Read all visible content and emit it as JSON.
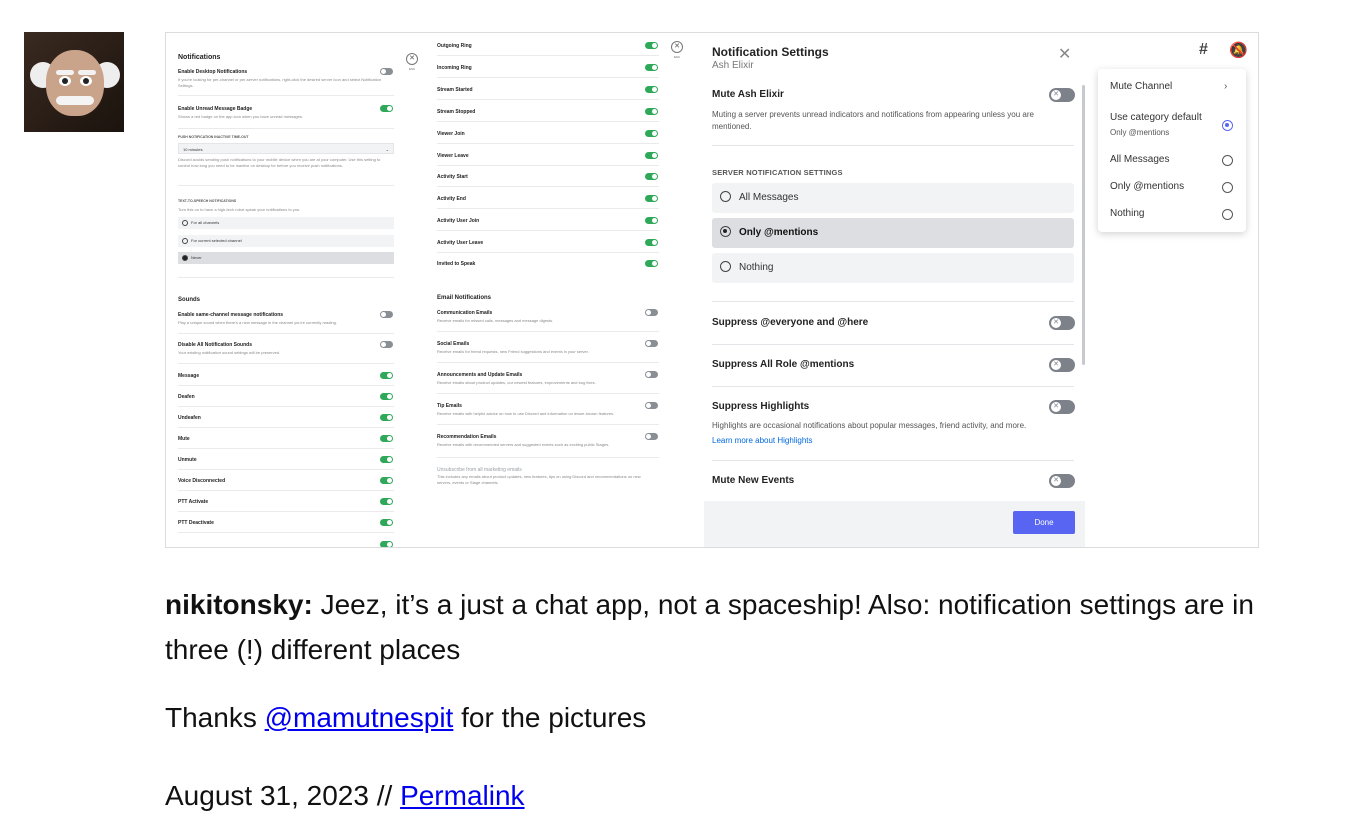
{
  "screenshot": {
    "panel1": {
      "heading": "Notifications",
      "rows": [
        {
          "label": "Enable Desktop Notifications",
          "desc": "If you're looking for per-channel or per-server notifications, right-click the desired server icon and select Notification Settings.",
          "on": false
        },
        {
          "label": "Enable Unread Message Badge",
          "desc": "Shows a red badge on the app icon when you have unread messages.",
          "on": true
        }
      ],
      "push_caption": "PUSH NOTIFICATION INACTIVE TIME-OUT",
      "push_select": "10 minutes",
      "push_desc": "Discord avoids sending push notifications to your mobile device when you are at your computer. Use this setting to control how long you need to be inactive on desktop for before you receive push notifications.",
      "tts_caption": "TEXT-TO-SPEECH NOTIFICATIONS",
      "tts_desc": "Turn this on to have a high-tech robot speak your notifications to you.",
      "tts_options": [
        "For all channels",
        "For current selected channel",
        "Never"
      ],
      "sounds_heading": "Sounds",
      "sound_rows": [
        {
          "label": "Enable same-channel message notifications",
          "desc": "Play a unique sound when there's a new message in the channel you're currently reading.",
          "on": false
        },
        {
          "label": "Disable All Notification Sounds",
          "desc": "Your existing notification sound settings will be preserved.",
          "on": false
        },
        {
          "label": "Message",
          "on": true
        },
        {
          "label": "Deafen",
          "on": true
        },
        {
          "label": "Undeafen",
          "on": true
        },
        {
          "label": "Mute",
          "on": true
        },
        {
          "label": "Unmute",
          "on": true
        },
        {
          "label": "Voice Disconnected",
          "on": true
        },
        {
          "label": "PTT Activate",
          "on": true
        },
        {
          "label": "PTT Deactivate",
          "on": true
        }
      ]
    },
    "panel2": {
      "esc_label": "ESC",
      "rows": [
        {
          "label": "Outgoing Ring",
          "on": true
        },
        {
          "label": "Incoming Ring",
          "on": true
        },
        {
          "label": "Stream Started",
          "on": true
        },
        {
          "label": "Stream Stopped",
          "on": true
        },
        {
          "label": "Viewer Join",
          "on": true
        },
        {
          "label": "Viewer Leave",
          "on": true
        },
        {
          "label": "Activity Start",
          "on": true
        },
        {
          "label": "Activity End",
          "on": true
        },
        {
          "label": "Activity User Join",
          "on": true
        },
        {
          "label": "Activity User Leave",
          "on": true
        },
        {
          "label": "Invited to Speak",
          "on": true
        }
      ],
      "email_heading": "Email Notifications",
      "email_rows": [
        {
          "label": "Communication Emails",
          "desc": "Receive emails for missed calls, messages and message digests.",
          "on": false
        },
        {
          "label": "Social Emails",
          "desc": "Receive emails for friend requests, new Friend suggestions and events in your server.",
          "on": false
        },
        {
          "label": "Announcements and Update Emails",
          "desc": "Receive emails about product updates, our newest features, improvements and bug fixes.",
          "on": false
        },
        {
          "label": "Tip Emails",
          "desc": "Receive emails with helpful advice on how to use Discord and information on lesser-known features.",
          "on": false
        },
        {
          "label": "Recommendation Emails",
          "desc": "Receive emails with recommended servers and suggested events such as exciting public Stages.",
          "on": false
        }
      ],
      "unsubscribe": "Unsubscribe from all marketing emails",
      "unsubscribe_desc": "This includes any emails about product updates, new features, tips on using Discord and recommendations on new servers, events or Stage channels."
    },
    "panel3": {
      "title": "Notification Settings",
      "subtitle": "Ash Elixir",
      "mute_label": "Mute Ash Elixir",
      "mute_desc": "Muting a server prevents unread indicators and notifications from appearing unless you are mentioned.",
      "server_caption": "SERVER NOTIFICATION SETTINGS",
      "options": [
        "All Messages",
        "Only @mentions",
        "Nothing"
      ],
      "selected_option": "Only @mentions",
      "suppress_everyone": "Suppress @everyone and @here",
      "suppress_roles": "Suppress All Role @mentions",
      "suppress_highlights": "Suppress Highlights",
      "highlights_desc": "Highlights are occasional notifications about popular messages, friend activity, and more.",
      "highlights_link": "Learn more about Highlights",
      "mute_events": "Mute New Events",
      "done": "Done"
    },
    "panel4": {
      "menu": {
        "mute_channel": "Mute Channel",
        "category_default": "Use category default",
        "category_default_sub": "Only @mentions",
        "all_messages": "All Messages",
        "only_mentions": "Only @mentions",
        "nothing": "Nothing"
      }
    }
  },
  "post": {
    "author": "nikitonsky:",
    "text": " Jeez, it’s a just a chat app, not a spaceship! Also: notification settings are in three (!) different places",
    "thanks_prefix": "Thanks ",
    "thanks_link": "@mamutnespit",
    "thanks_suffix": " for the pictures",
    "date": "August 31, 2023 // ",
    "permalink": "Permalink"
  },
  "colors": {
    "toggle_on": "#2fa85a",
    "toggle_off": "#8a8f96",
    "blurple": "#5865f2",
    "link": "#0000ee"
  }
}
